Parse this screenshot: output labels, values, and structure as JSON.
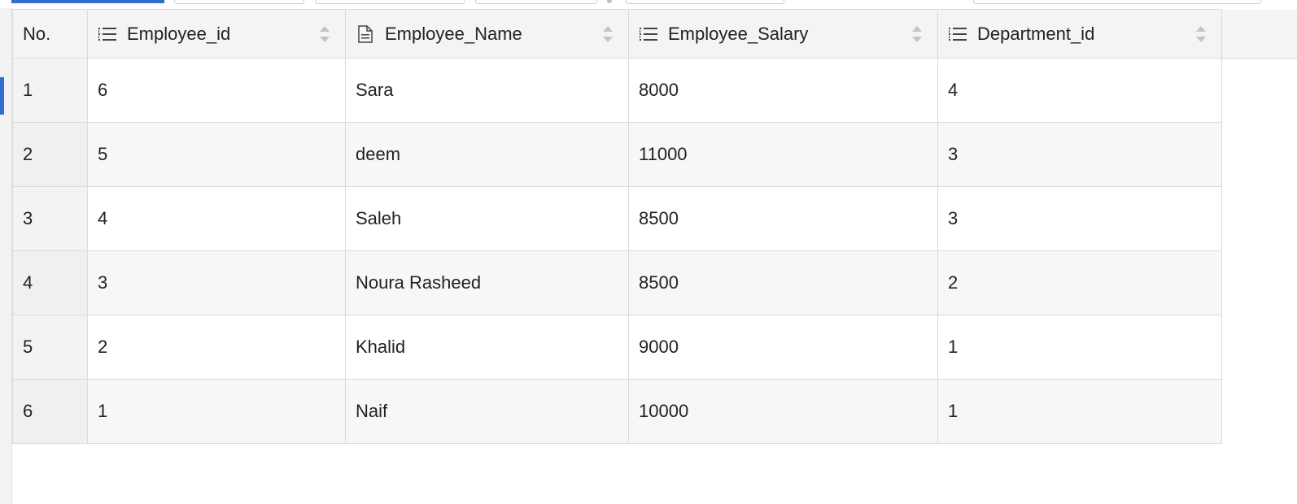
{
  "colors": {
    "accent": "#2f6fcf",
    "header_bg": "#f4f4f4",
    "grid_line": "#dadada"
  },
  "table": {
    "columns": [
      {
        "label": "No.",
        "icon": "none"
      },
      {
        "label": "Employee_id",
        "icon": "list-icon"
      },
      {
        "label": "Employee_Name",
        "icon": "document-icon"
      },
      {
        "label": "Employee_Salary",
        "icon": "list-icon"
      },
      {
        "label": "Department_id",
        "icon": "list-icon"
      }
    ],
    "rows": [
      {
        "no": "1",
        "employee_id": "6",
        "employee_name": "Sara",
        "employee_salary": "8000",
        "department_id": "4"
      },
      {
        "no": "2",
        "employee_id": "5",
        "employee_name": "deem",
        "employee_salary": "11000",
        "department_id": "3"
      },
      {
        "no": "3",
        "employee_id": "4",
        "employee_name": "Saleh",
        "employee_salary": "8500",
        "department_id": "3"
      },
      {
        "no": "4",
        "employee_id": "3",
        "employee_name": "Noura Rasheed",
        "employee_salary": "8500",
        "department_id": "2"
      },
      {
        "no": "5",
        "employee_id": "2",
        "employee_name": "Khalid",
        "employee_salary": "9000",
        "department_id": "1"
      },
      {
        "no": "6",
        "employee_id": "1",
        "employee_name": "Naif",
        "employee_salary": "10000",
        "department_id": "1"
      }
    ]
  }
}
